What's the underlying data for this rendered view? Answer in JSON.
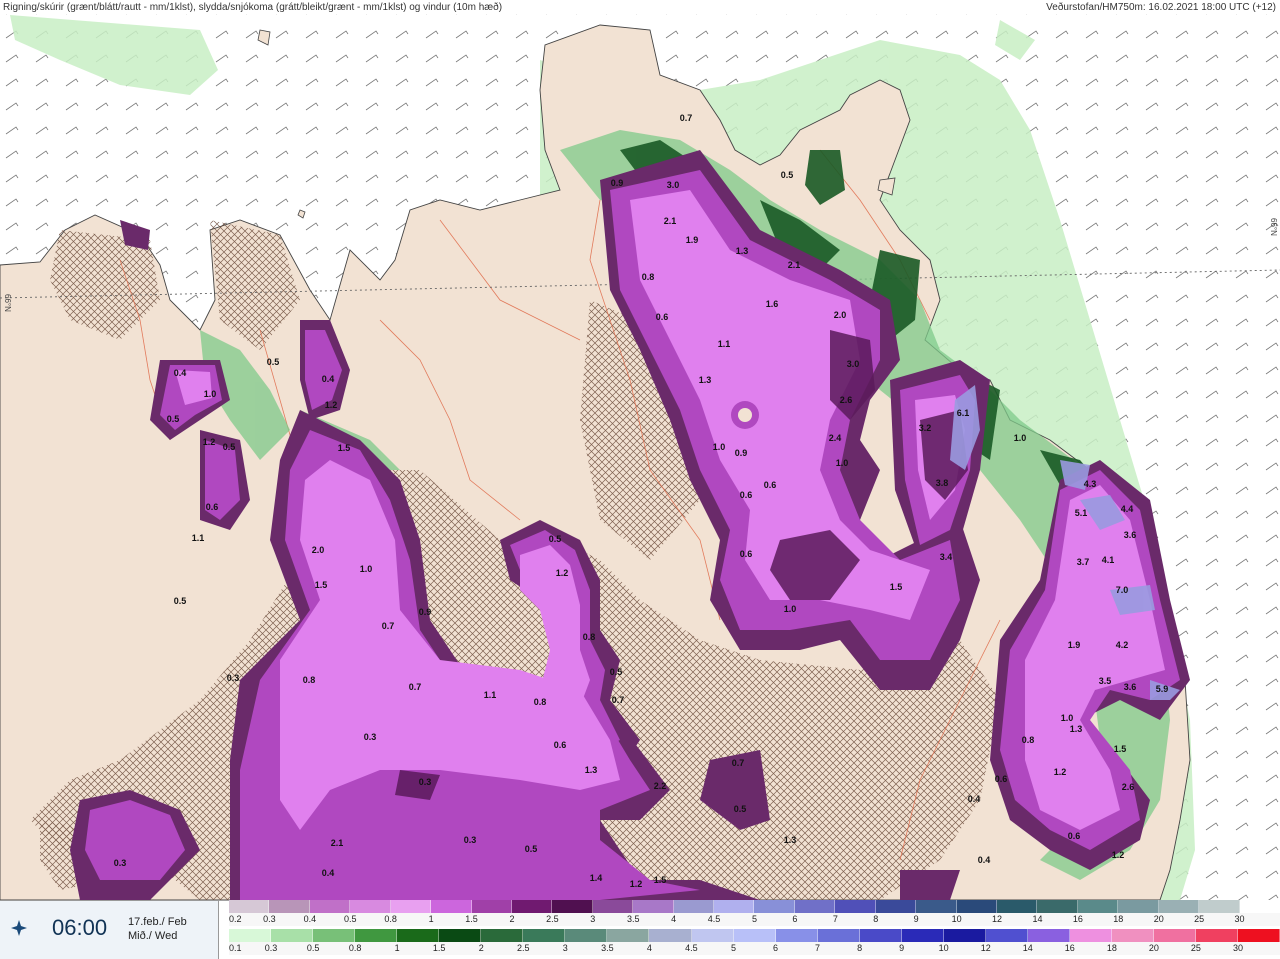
{
  "header": {
    "title": "Rigning/skúrir (grænt/blátt/rautt - mm/1klst), slydda/snjókoma (grátt/bleikt/grænt - mm/1klst) og vindur (10m hæð)",
    "source": "Veðurstofan/HM750m: 16.02.2021 18:00 UTC (+12)"
  },
  "map": {
    "lat_label": "66°N",
    "colors": {
      "sea": "#ffffff",
      "land": "#f2e2d3",
      "hatch": "#6b4a3a",
      "rivers": "#e07050",
      "coast": "#444444",
      "rain_light": "#c8f0c8",
      "snow_core": "#cc55dd",
      "snow_dark": "#5a1a5a"
    },
    "precip_values": [
      "0.7",
      "0.5",
      "0.9",
      "3.0",
      "2.1",
      "1.9",
      "0.8",
      "0.6",
      "1.3",
      "1.1",
      "1.6",
      "1.3",
      "2.1",
      "2.0",
      "3.0",
      "2.6",
      "2.4",
      "1.0",
      "1.0",
      "0.9",
      "1.0",
      "0.6",
      "0.6",
      "0.6",
      "3.2",
      "6.1",
      "3.8",
      "3.4",
      "1.5",
      "1.0",
      "4.3",
      "5.1",
      "4.4",
      "3.6",
      "3.7",
      "4.1",
      "7.0",
      "4.2",
      "1.9",
      "3.5",
      "3.6",
      "5.9",
      "1.0",
      "1.3",
      "0.8",
      "1.5",
      "1.2",
      "2.6",
      "0.6",
      "0.4",
      "0.6",
      "1.2",
      "0.4",
      "0.5",
      "0.4",
      "1.0",
      "1.2",
      "0.5",
      "0.6",
      "1.1",
      "0.5",
      "0.3",
      "0.5",
      "0.4",
      "1.2",
      "1.5",
      "2.0",
      "1.0",
      "1.5",
      "0.9",
      "0.7",
      "0.7",
      "0.8",
      "0.3",
      "0.5",
      "1.2",
      "0.8",
      "0.5",
      "0.7",
      "1.1",
      "0.8",
      "0.6",
      "1.3",
      "0.7",
      "0.3",
      "2.2",
      "0.5",
      "0.3",
      "2.1",
      "0.4",
      "0.5",
      "1.4",
      "1.2",
      "1.5",
      "1.3",
      "0.3",
      "0.7"
    ]
  },
  "time_box": {
    "time": "06:00",
    "date_line1": "17.feb./ Feb",
    "date_line2": "Mið./ Wed"
  },
  "legend_precip": {
    "labels": [
      "0.2",
      "0.3",
      "0.4",
      "0.5",
      "0.8",
      "1",
      "1.5",
      "2",
      "2.5",
      "3",
      "3.5",
      "4",
      "4.5",
      "5",
      "6",
      "7",
      "8",
      "9",
      "10",
      "12",
      "14",
      "16",
      "18",
      "20",
      "25",
      "30"
    ],
    "colors": [
      "#d6c8d6",
      "#b895b8",
      "#c070c8",
      "#d88ae0",
      "#e8a0f0",
      "#cc66dd",
      "#a040a8",
      "#701a70",
      "#501050",
      "#8a4a9a",
      "#a878c8",
      "#9a9ad0",
      "#b0b0ee",
      "#8890d8",
      "#7070c8",
      "#5050b8",
      "#3a4a9a",
      "#3a5a8a",
      "#2a4a7a",
      "#2a5a6a",
      "#3a6a6a",
      "#5a8a8a",
      "#7a9aa0",
      "#9ab0b4",
      "#c0cccc",
      "#ffffff"
    ]
  },
  "legend_snow": {
    "labels": [
      "0.1",
      "0.3",
      "0.5",
      "0.8",
      "1",
      "1.5",
      "2",
      "2.5",
      "3",
      "3.5",
      "4",
      "4.5",
      "5",
      "6",
      "7",
      "8",
      "9",
      "10",
      "12",
      "14",
      "16",
      "18",
      "20",
      "25",
      "30"
    ],
    "colors": [
      "#d8f8d8",
      "#a8e0a8",
      "#78c078",
      "#409840",
      "#1a6a1a",
      "#0a4a14",
      "#2a6a3a",
      "#3a7a5a",
      "#5a8a7a",
      "#8aa6a0",
      "#a8b0d0",
      "#c0c6f0",
      "#b8c0f8",
      "#8890e8",
      "#6a70d8",
      "#4a4ac8",
      "#2a2ab8",
      "#1a1aa0",
      "#5050d0",
      "#8a60e0",
      "#ee90e0",
      "#f090c0",
      "#f070a0",
      "#f04060",
      "#ee1020"
    ]
  }
}
